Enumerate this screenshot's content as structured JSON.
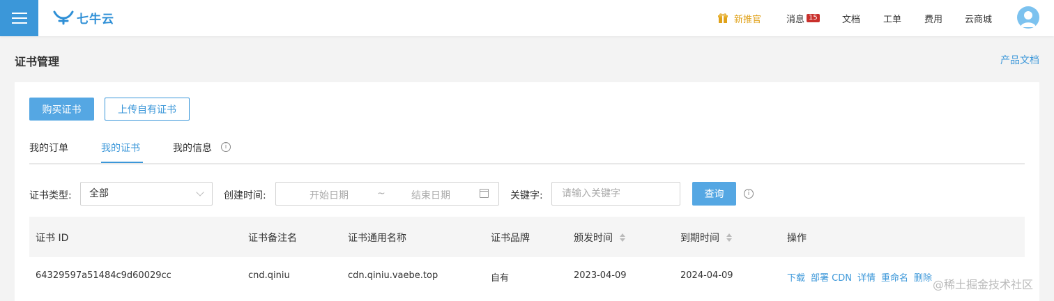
{
  "header": {
    "brand": "七牛云",
    "nav": {
      "new_promo": "新推官",
      "messages": "消息",
      "messages_count": "15",
      "docs": "文档",
      "tickets": "工单",
      "billing": "费用",
      "marketplace": "云商城"
    }
  },
  "page": {
    "title": "证书管理",
    "product_docs": "产品文档"
  },
  "actions": {
    "buy": "购买证书",
    "upload": "上传自有证书"
  },
  "tabs": [
    {
      "label": "我的订单",
      "active": false
    },
    {
      "label": "我的证书",
      "active": true
    },
    {
      "label": "我的信息",
      "active": false
    }
  ],
  "filters": {
    "type_label": "证书类型:",
    "type_value": "全部",
    "created_label": "创建时间:",
    "start_placeholder": "开始日期",
    "range_sep": "~",
    "end_placeholder": "结束日期",
    "keyword_label": "关键字:",
    "keyword_placeholder": "请输入关键字",
    "query": "查询"
  },
  "table": {
    "columns": [
      "证书 ID",
      "证书备注名",
      "证书通用名称",
      "证书品牌",
      "颁发时间",
      "到期时间",
      "操作"
    ],
    "rows": [
      {
        "id": "64329597a51484c9d60029cc",
        "remark": "cnd.qiniu",
        "common_name": "cdn.qiniu.vaebe.top",
        "brand": "自有",
        "issued": "2023-04-09",
        "expires": "2024-04-09",
        "ops": [
          "下载",
          "部署 CDN",
          "详情",
          "重命名",
          "删除"
        ]
      }
    ]
  },
  "watermark": "@稀土掘金技术社区",
  "colors": {
    "accent": "#3b97d9",
    "button_fill": "#55a7e3",
    "promo": "#e0a21a",
    "badge": "#c9302c"
  },
  "icons": [
    "menu-icon",
    "qiniu-logo-icon",
    "gift-icon",
    "avatar-icon",
    "info-icon",
    "chevron-down-icon",
    "calendar-icon",
    "sort-icon"
  ]
}
